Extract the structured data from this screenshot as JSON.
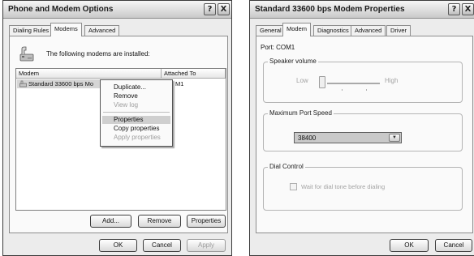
{
  "dialog1": {
    "title": "Phone and Modem Options",
    "caption_buttons": [
      "?",
      "X"
    ],
    "tabs": [
      {
        "label": "Dialing Rules",
        "active": false
      },
      {
        "label": "Modems",
        "active": true
      },
      {
        "label": "Advanced",
        "active": false
      }
    ],
    "intro_text": "The following modems are installed:",
    "list": {
      "columns": [
        "Modem",
        "Attached To"
      ],
      "rows": [
        {
          "modem": "Standard 33600 bps Mo",
          "attached": "M1"
        }
      ]
    },
    "context_menu": [
      {
        "label": "Duplicate...",
        "disabled": false,
        "highlighted": false
      },
      {
        "label": "Remove",
        "disabled": false,
        "highlighted": false
      },
      {
        "label": "View log",
        "disabled": true,
        "highlighted": false
      },
      {
        "label": "Properties",
        "disabled": false,
        "highlighted": true
      },
      {
        "label": "Copy properties",
        "disabled": false,
        "highlighted": false
      },
      {
        "label": "Apply properties",
        "disabled": true,
        "highlighted": false
      }
    ],
    "buttons": {
      "add": "Add...",
      "remove": "Remove",
      "properties": "Properties",
      "ok": "OK",
      "cancel": "Cancel",
      "apply": "Apply"
    }
  },
  "dialog2": {
    "title": "Standard 33600 bps Modem Properties",
    "caption_buttons": [
      "?",
      "X"
    ],
    "tabs": [
      {
        "label": "General",
        "active": false
      },
      {
        "label": "Modem",
        "active": true
      },
      {
        "label": "Diagnostics",
        "active": false
      },
      {
        "label": "Advanced",
        "active": false
      },
      {
        "label": "Driver",
        "active": false
      }
    ],
    "port": "Port:  COM1",
    "speaker_volume": {
      "legend": "Speaker volume",
      "low": "Low",
      "high": "High",
      "level": 0
    },
    "max_port_speed": {
      "legend": "Maximum Port Speed",
      "value": "38400"
    },
    "dial_control": {
      "legend": "Dial Control",
      "checkbox_label": "Wait for dial tone before dialing",
      "checked": false
    },
    "buttons": {
      "ok": "OK",
      "cancel": "Cancel"
    }
  },
  "colors": {
    "dialog_bg": "#ececec",
    "panel_bg": "#fafafa",
    "highlight": "#cfcfcf",
    "disabled_text": "#9d9d9d"
  }
}
